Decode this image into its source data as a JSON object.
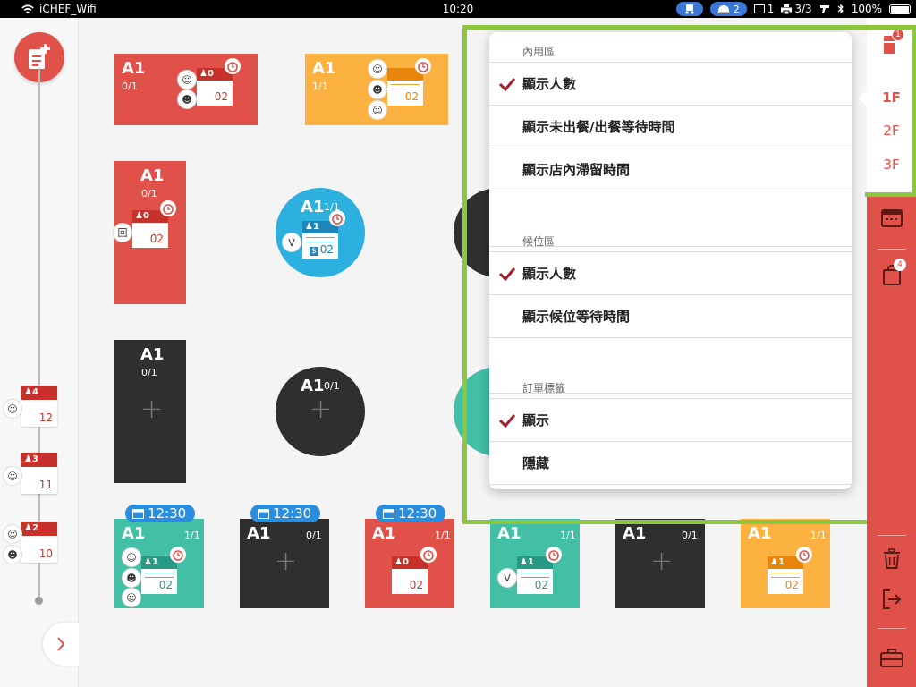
{
  "status_bar": {
    "carrier": "iCHEF_Wifi",
    "time": "10:20",
    "delivery_count": "2",
    "screens": "1",
    "printers": "3/3",
    "battery": "100%"
  },
  "timeline": {
    "orders": [
      {
        "guests": "4",
        "number": "12"
      },
      {
        "guests": "3",
        "number": "11"
      },
      {
        "guests": "2",
        "number": "10"
      }
    ]
  },
  "tables": [
    {
      "name": "A1",
      "occupancy": "0/1",
      "guests": "0",
      "order_no": "02"
    },
    {
      "name": "A1",
      "occupancy": "1/1",
      "order_no": "02"
    },
    {
      "name": "A1",
      "occupancy": "0/1",
      "guests": "0",
      "order_no": "02"
    },
    {
      "name": "A1",
      "occupancy": "1/1",
      "guests": "1",
      "order_no": "02",
      "tag": "V",
      "paid": "$"
    },
    {
      "name": "A1",
      "occupancy": "0/1"
    },
    {
      "name": "A1",
      "occupancy": "0/1"
    },
    {
      "name": "A1",
      "occupancy": "1/1",
      "guests": "1",
      "order_no": "02",
      "reservation": "12:30"
    },
    {
      "name": "A1",
      "occupancy": "0/1",
      "reservation": "12:30"
    },
    {
      "name": "A1",
      "occupancy": "1/1",
      "guests": "0",
      "order_no": "02",
      "reservation": "12:30"
    },
    {
      "name": "A1",
      "occupancy": "1/1",
      "guests": "1",
      "order_no": "02",
      "tag": "V"
    },
    {
      "name": "A1",
      "occupancy": "0/1"
    },
    {
      "name": "A1",
      "occupancy": "1/1",
      "guests": "1",
      "order_no": "02"
    }
  ],
  "dropdown": {
    "dine_in": {
      "title": "內用區",
      "items": [
        {
          "label": "顯示人數",
          "checked": true
        },
        {
          "label": "顯示未出餐/出餐等待時間",
          "checked": false
        },
        {
          "label": "顯示店內滯留時間",
          "checked": false
        }
      ]
    },
    "waiting": {
      "title": "候位區",
      "items": [
        {
          "label": "顯示人數",
          "checked": true
        },
        {
          "label": "顯示候位等待時間",
          "checked": false
        }
      ]
    },
    "order_tags": {
      "title": "訂單標籤",
      "items": [
        {
          "label": "顯示",
          "checked": true
        },
        {
          "label": "隱藏",
          "checked": false
        }
      ]
    }
  },
  "right_rail": {
    "settings_badge": "1",
    "floors": [
      "1F",
      "2F",
      "3F"
    ],
    "active_floor": "1F",
    "bag_badge": "4"
  },
  "colors": {
    "brand_red": "#e0514a",
    "highlight_green": "#8dc63f",
    "reservation_blue": "#2a8ee0",
    "check_red": "#a41e2c"
  }
}
